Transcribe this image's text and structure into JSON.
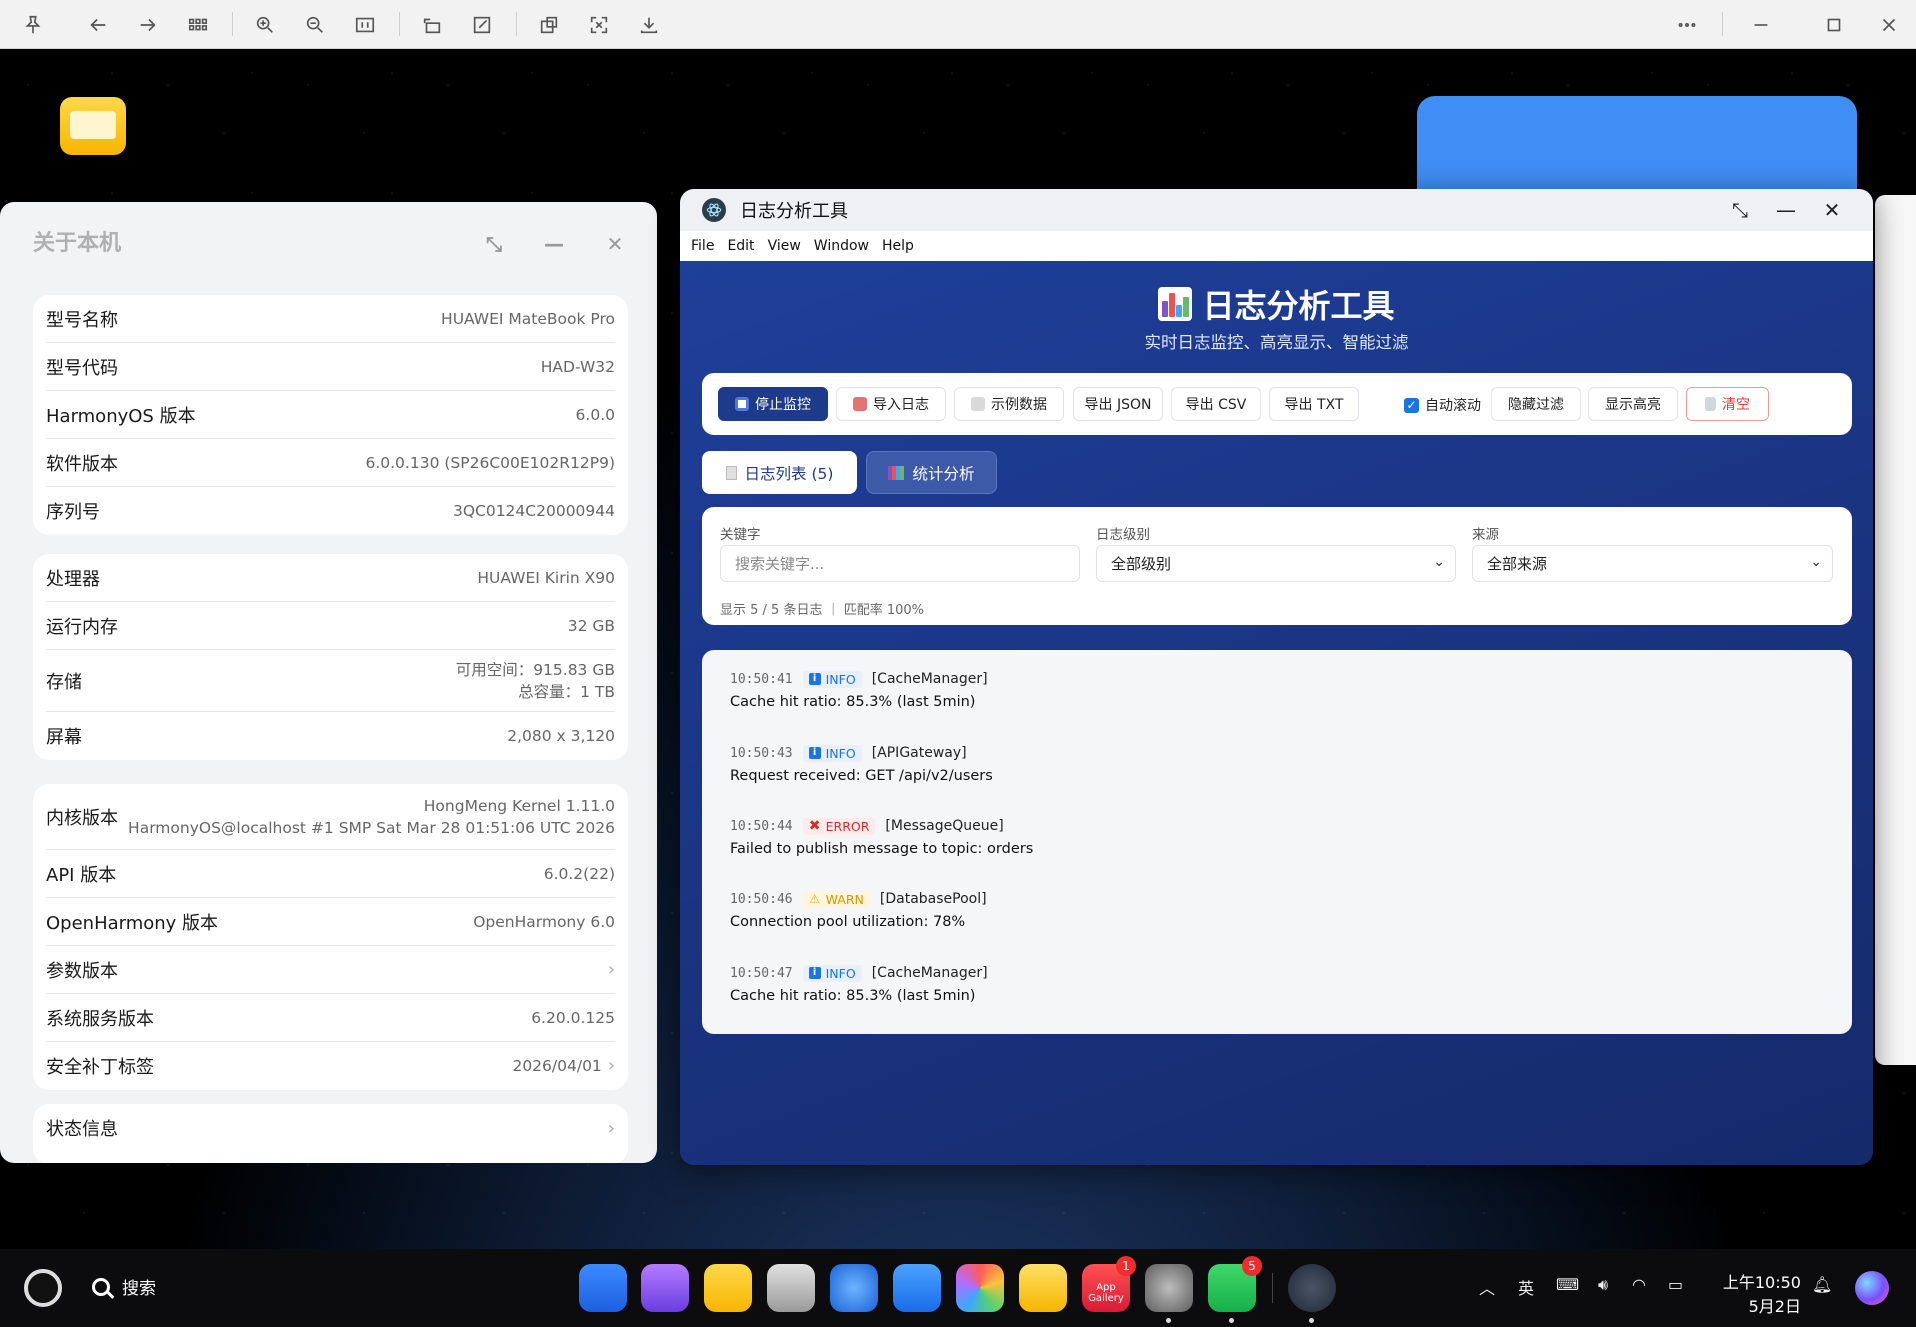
{
  "viewer_toolbar": {
    "icons": [
      "pin-icon",
      "back-icon",
      "forward-icon",
      "grid-icon",
      "zoom-in-icon",
      "zoom-out-icon",
      "actual-size-icon",
      "rotate-icon",
      "edit-icon",
      "screenshot-icon",
      "fit-icon",
      "save-icon",
      "more-icon",
      "minimize-icon",
      "maximize-icon",
      "close-icon"
    ]
  },
  "about": {
    "title": "关于本机",
    "group1": [
      {
        "key": "型号名称",
        "value": "HUAWEI MateBook Pro"
      },
      {
        "key": "型号代码",
        "value": "HAD-W32"
      },
      {
        "key": "HarmonyOS 版本",
        "value": "6.0.0"
      },
      {
        "key": "软件版本",
        "value": "6.0.0.130 (SP26C00E102R12P9)"
      },
      {
        "key": "序列号",
        "value": "3QC0124C20000944"
      }
    ],
    "group2": {
      "cpu": {
        "key": "处理器",
        "value": "HUAWEI Kirin X90"
      },
      "ram": {
        "key": "运行内存",
        "value": "32 GB"
      },
      "storage": {
        "key": "存储",
        "value1": "可用空间：915.83 GB",
        "value2": "总容量：1 TB"
      },
      "screen": {
        "key": "屏幕",
        "value": "2,080 x 3,120"
      }
    },
    "group3": {
      "kernel": {
        "key": "内核版本",
        "value1": "HongMeng Kernel 1.11.0",
        "value2": "HarmonyOS@localhost #1 SMP Sat Mar 28 01:51:06 UTC 2026"
      },
      "api": {
        "key": "API 版本",
        "value": "6.0.2(22)"
      },
      "openharmony": {
        "key": "OpenHarmony 版本",
        "value": "OpenHarmony 6.0"
      },
      "params": {
        "key": "参数版本",
        "value": ""
      },
      "sysservice": {
        "key": "系统服务版本",
        "value": "6.20.0.125"
      },
      "patch": {
        "key": "安全补丁标签",
        "value": "2026/04/01"
      }
    },
    "group4": {
      "key": "状态信息"
    }
  },
  "logwin": {
    "title": "日志分析工具",
    "menu": [
      "File",
      "Edit",
      "View",
      "Window",
      "Help"
    ],
    "hero_title": "日志分析工具",
    "hero_sub": "实时日志监控、高亮显示、智能过滤",
    "toolbar": {
      "stop": "停止监控",
      "import": "导入日志",
      "sample": "示例数据",
      "export_json": "导出 JSON",
      "export_csv": "导出 CSV",
      "export_txt": "导出 TXT",
      "autoscroll": "自动滚动",
      "hide_filter": "隐藏过滤",
      "show_highlight": "显示高亮",
      "clear": "清空"
    },
    "tabs": {
      "list": "日志列表 (5)",
      "stats": "统计分析"
    },
    "filters": {
      "keyword_label": "关键字",
      "keyword_placeholder": "搜索关键字...",
      "level_label": "日志级别",
      "level_value": "全部级别",
      "source_label": "来源",
      "source_value": "全部来源",
      "stats": "显示 5 / 5 条日志 ｜ 匹配率 100%"
    },
    "logs": [
      {
        "time": "10:50:41",
        "level": "INFO",
        "source": "[CacheManager]",
        "message": "Cache hit ratio: 85.3% (last 5min)"
      },
      {
        "time": "10:50:43",
        "level": "INFO",
        "source": "[APIGateway]",
        "message": "Request received: GET /api/v2/users"
      },
      {
        "time": "10:50:44",
        "level": "ERROR",
        "source": "[MessageQueue]",
        "message": "Failed to publish message to topic: orders"
      },
      {
        "time": "10:50:46",
        "level": "WARN",
        "source": "[DatabasePool]",
        "message": "Connection pool utilization: 78%"
      },
      {
        "time": "10:50:47",
        "level": "INFO",
        "source": "[CacheManager]",
        "message": "Cache hit ratio: 85.3% (last 5min)"
      }
    ]
  },
  "taskbar": {
    "search": "搜索",
    "appgallery_line1": "App",
    "appgallery_line2": "Gallery",
    "appgallery_badge": "1",
    "wechat_badge": "5",
    "ime": "英",
    "time": "上午10:50",
    "date": "5月2日"
  }
}
